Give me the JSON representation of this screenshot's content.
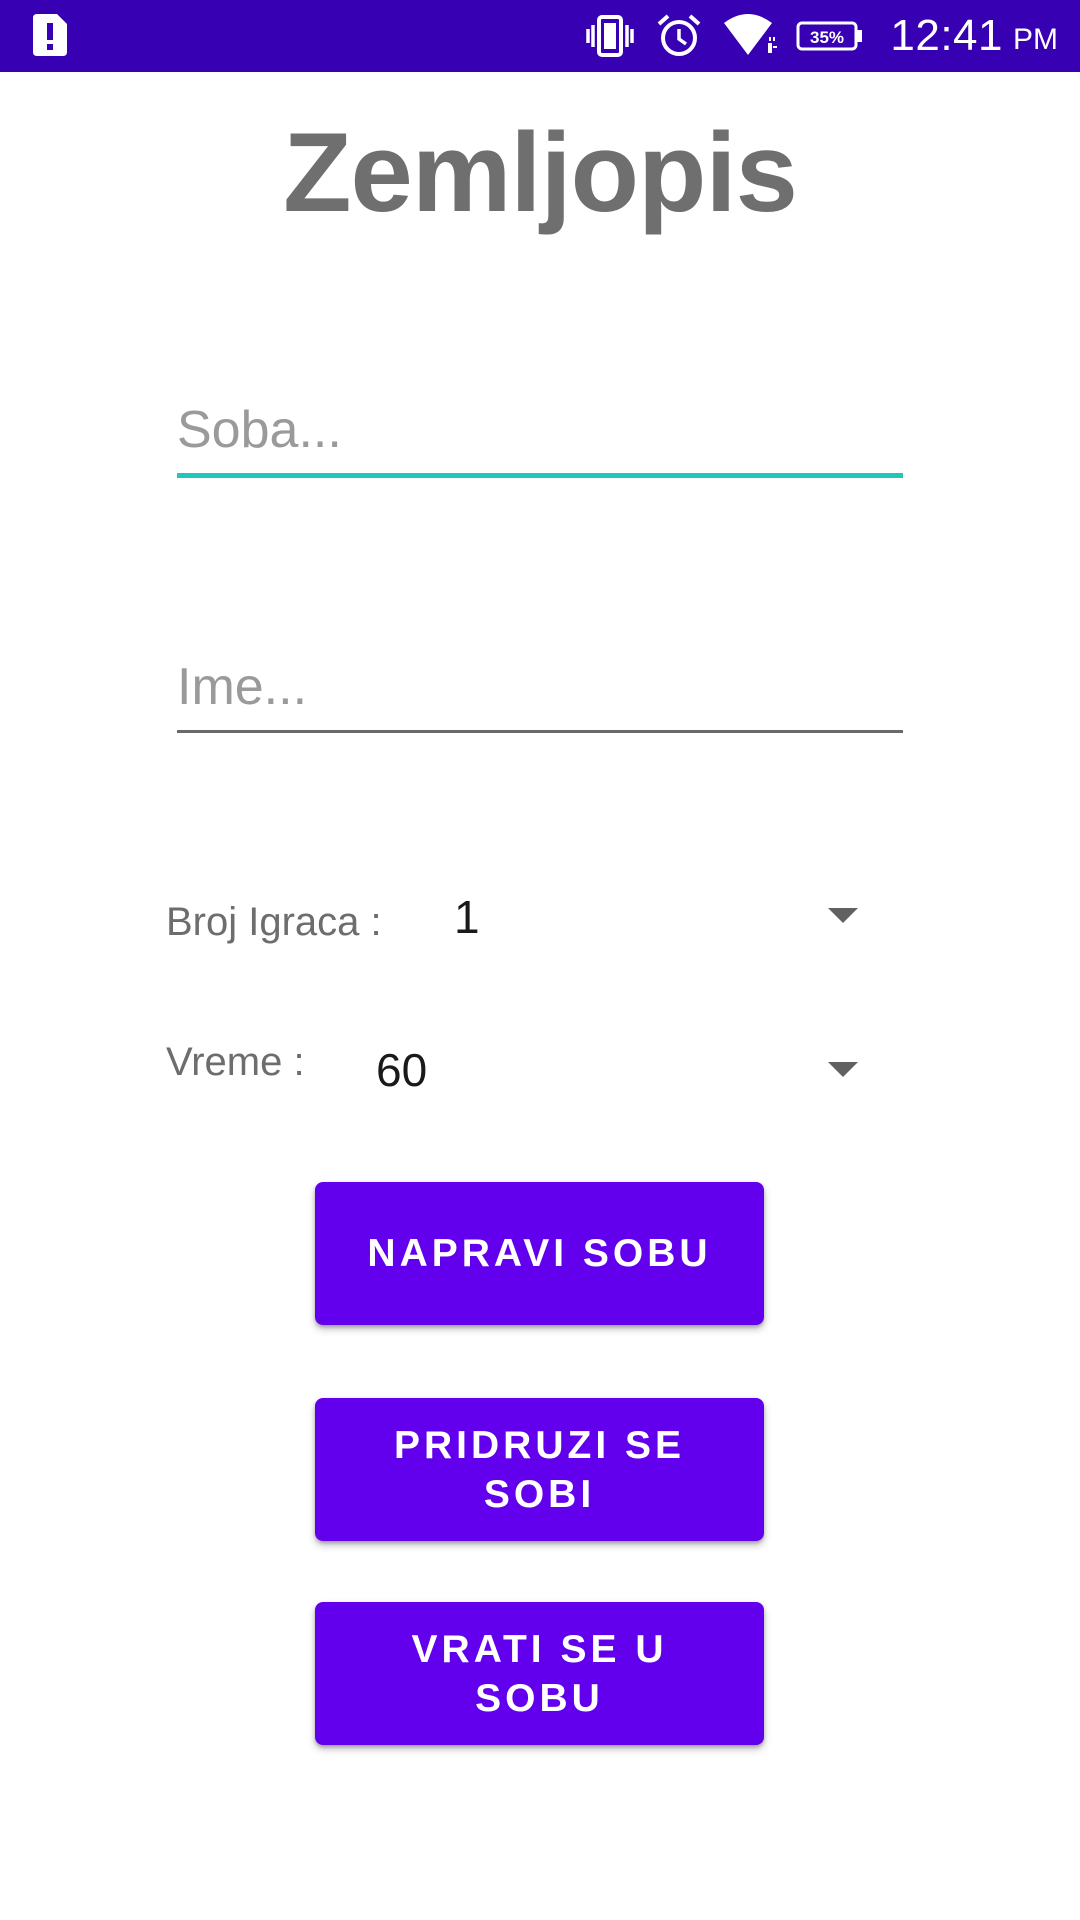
{
  "status_bar": {
    "time": "12:41",
    "ampm": "PM",
    "battery": "35%",
    "bg_color": "#3700b3",
    "icons": [
      "alert-sim-icon",
      "vibrate-icon",
      "alarm-icon",
      "wifi-icon",
      "battery-icon"
    ]
  },
  "app": {
    "title": "Zemljopis"
  },
  "form": {
    "room_field": {
      "placeholder": "Soba...",
      "value": "",
      "accent_color": "#1fc8b8"
    },
    "name_field": {
      "placeholder": "Ime...",
      "value": ""
    },
    "players": {
      "label": "Broj Igraca :",
      "selected": "1"
    },
    "time": {
      "label": "Vreme :",
      "selected": "60"
    }
  },
  "buttons": {
    "create_room": "NAPRAVI SOBU",
    "join_room": "PRIDRUZI SE SOBI",
    "return_room": "VRATI SE U SOBU",
    "color": "#6200ee"
  }
}
